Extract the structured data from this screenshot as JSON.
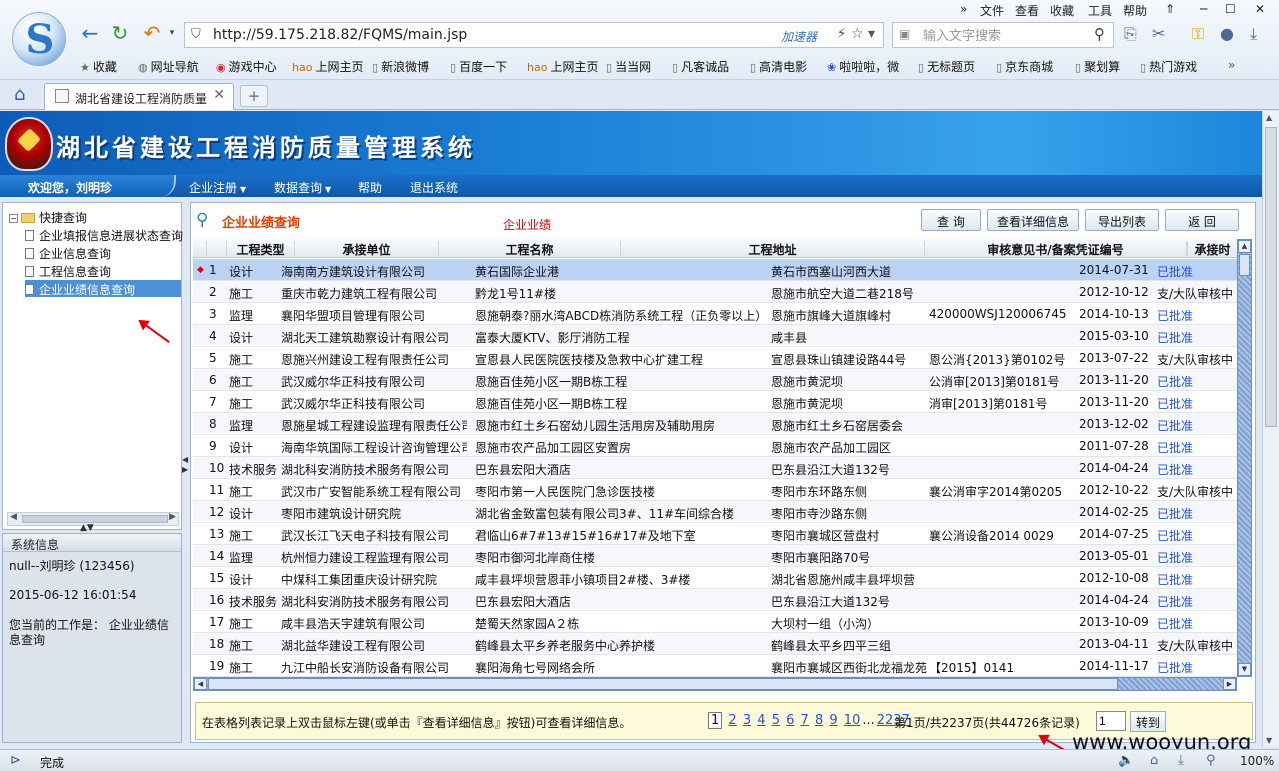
{
  "browser": {
    "menu": [
      "文件",
      "查看",
      "收藏",
      "工具",
      "帮助"
    ],
    "url": "http://59.175.218.82/FQMS/main.jsp",
    "accelerator_label": "加速器",
    "search_placeholder": "输入文字搜索",
    "favorites": [
      {
        "icon": "star-icon",
        "label": "收藏"
      },
      {
        "icon": "globe-icon",
        "label": "网址导航"
      },
      {
        "icon": "game-icon",
        "label": "游戏中心"
      },
      {
        "icon": "hao-icon",
        "label": "上网主页"
      },
      {
        "icon": "page-icon",
        "label": "新浪微博"
      },
      {
        "icon": "page-icon",
        "label": "百度一下"
      },
      {
        "icon": "hao-icon",
        "label": "上网主页"
      },
      {
        "icon": "page-icon",
        "label": "当当网"
      },
      {
        "icon": "page-icon",
        "label": "凡客诚品"
      },
      {
        "icon": "page-icon",
        "label": "高清电影"
      },
      {
        "icon": "paw-icon",
        "label": "啦啦啦，微"
      },
      {
        "icon": "page-icon",
        "label": "无标题页"
      },
      {
        "icon": "page-icon",
        "label": "京东商城"
      },
      {
        "icon": "page-icon",
        "label": "聚划算"
      },
      {
        "icon": "page-icon",
        "label": "热门游戏"
      }
    ],
    "tab_title": "湖北省建设工程消防质量",
    "status_text": "完成",
    "zoom": "100%"
  },
  "app": {
    "title": "湖北省建设工程消防质量管理系统",
    "welcome": "欢迎您，刘明珍",
    "menu": [
      {
        "label": "企业注册",
        "dropdown": true
      },
      {
        "label": "数据查询",
        "dropdown": true
      },
      {
        "label": "帮助",
        "dropdown": false
      },
      {
        "label": "退出系统",
        "dropdown": false
      }
    ]
  },
  "tree": {
    "root": "快捷查询",
    "items": [
      "企业填报信息进展状态查询",
      "企业信息查询",
      "工程信息查询",
      "企业业绩信息查询"
    ],
    "selected_index": 3
  },
  "sysinfo": {
    "title": "系统信息",
    "user": "null--刘明珍 (123456)",
    "datetime": "2015-06-12 16:01:54",
    "current_work": "您当前的工作是： 企业业绩信息查询"
  },
  "query": {
    "title": "企业业绩查询",
    "red_label": "企业业绩",
    "buttons": [
      "查 询",
      "查看详细信息",
      "导出列表",
      "返 回"
    ]
  },
  "grid": {
    "columns": [
      "",
      "",
      "工程类型",
      "承接单位",
      "工程名称",
      "工程地址",
      "审核意见书/备案凭证编号",
      "",
      "承接时"
    ],
    "rows": [
      [
        "1",
        "设计",
        "海南南方建筑设计有限公司",
        "黄石国际企业港",
        "黄石市西塞山河西大道",
        "",
        "2014-07-31",
        "已批准"
      ],
      [
        "2",
        "施工",
        "重庆市乾力建筑工程有限公司",
        "黔龙1号11#楼",
        "恩施市航空大道二巷218号",
        "",
        "2012-10-12",
        "支/大队审核中"
      ],
      [
        "3",
        "监理",
        "襄阳华盟项目管理有限公司",
        "恩施朝泰?丽水湾ABCD栋消防系统工程（正负零以上）",
        "恩施市旗峰大道旗峰村",
        "420000WSJ120006745",
        "2014-10-13",
        "已批准"
      ],
      [
        "4",
        "设计",
        "湖北天工建筑勘察设计有限公司",
        "富泰大厦KTV、影厅消防工程",
        "咸丰县",
        "",
        "2015-03-10",
        "已批准"
      ],
      [
        "5",
        "施工",
        "恩施兴州建设工程有限责任公司",
        "宣恩县人民医院医技楼及急救中心扩建工程",
        "宣恩县珠山镇建设路44号",
        "恩公消{2013}第0102号",
        "2013-07-22",
        "支/大队审核中"
      ],
      [
        "6",
        "施工",
        "武汉威尔华正科技有限公司",
        "恩施百佳苑小区一期B栋工程",
        "恩施市黄泥坝",
        "公消审[2013]第0181号",
        "2013-11-20",
        "已批准"
      ],
      [
        "7",
        "施工",
        "武汉威尔华正科技有限公司",
        "恩施百佳苑小区一期B栋工程",
        "恩施市黄泥坝",
        "消审[2013]第0181号",
        "2013-11-20",
        "已批准"
      ],
      [
        "8",
        "监理",
        "恩施星城工程建设监理有限责任公司",
        "恩施市红土乡石窑幼儿园生活用房及辅助用房",
        "恩施市红土乡石窑居委会",
        "",
        "2013-12-02",
        "已批准"
      ],
      [
        "9",
        "设计",
        "海南华筑国际工程设计咨询管理公司",
        "恩施市农产品加工园区安置房",
        "恩施市农产品加工园区",
        "",
        "2011-07-28",
        "已批准"
      ],
      [
        "10",
        "技术服务",
        "湖北科安消防技术服务有限公司",
        "巴东县宏阳大酒店",
        "巴东县沿江大道132号",
        "",
        "2014-04-24",
        "已批准"
      ],
      [
        "11",
        "施工",
        "武汉市广安智能系统工程有限公司",
        "枣阳市第一人民医院门急诊医技楼",
        "枣阳市东环路东侧",
        "襄公消审字2014第0205",
        "2012-10-22",
        "支/大队审核中"
      ],
      [
        "12",
        "设计",
        "枣阳市建筑设计研究院",
        "湖北省金致富包装有限公司3#、11#车间综合楼",
        "枣阳市寺沙路东侧",
        "",
        "2014-02-25",
        "已批准"
      ],
      [
        "13",
        "施工",
        "武汉长江飞天电子科技有限公司",
        "君临山6#7#13#15#16#17#及地下室",
        "枣阳市襄城区营盘村",
        "襄公消设备2014 0029",
        "2014-07-25",
        "已批准"
      ],
      [
        "14",
        "监理",
        "杭州恒力建设工程监理有限公司",
        "枣阳市御河北岸商住楼",
        "枣阳市襄阳路70号",
        "",
        "2013-05-01",
        "已批准"
      ],
      [
        "15",
        "设计",
        "中煤科工集团重庆设计研究院",
        "咸丰县坪坝营恩菲小镇项目2#楼、3#楼",
        "湖北省恩施州咸丰县坪坝营",
        "",
        "2012-10-08",
        "已批准"
      ],
      [
        "16",
        "技术服务",
        "湖北科安消防技术服务有限公司",
        "巴东县宏阳大酒店",
        "巴东县沿江大道132号",
        "",
        "2014-04-24",
        "已批准"
      ],
      [
        "17",
        "施工",
        "咸丰县浩天宇建筑有限公司",
        "楚蜀天然家园A２栋",
        "大坝村一组（小沟）",
        "",
        "2013-10-09",
        "已批准"
      ],
      [
        "18",
        "施工",
        "湖北益华建设工程有限公司",
        "鹤峰县太平乡养老服务中心养护楼",
        "鹤峰县太平乡四平三组",
        "",
        "2013-04-11",
        "支/大队审核中"
      ],
      [
        "19",
        "施工",
        "九江中船长安消防设备有限公司",
        "襄阳海角七号网络会所",
        "襄阳市襄城区西街北龙福龙苑",
        "【2015】0141",
        "2014-11-17",
        "已批准"
      ]
    ],
    "selected_row": 0
  },
  "pager": {
    "hint": "在表格列表记录上双击鼠标左键(或单击『查看详细信息』按钮)可查看详细信息。",
    "pages": [
      "1",
      "2",
      "3",
      "4",
      "5",
      "6",
      "7",
      "8",
      "9",
      "10"
    ],
    "ellipsis": "...",
    "last_page": "2237",
    "current_page": "1",
    "summary": "第1页/共2237页(共44726条记录)",
    "goto_value": "1",
    "goto_label": "转到"
  },
  "watermark": "www.wooyun.org"
}
